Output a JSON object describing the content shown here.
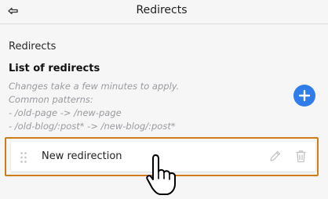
{
  "header": {
    "title": "Redirects",
    "back_icon": "back-arrow-icon"
  },
  "section": {
    "label": "Redirects"
  },
  "list": {
    "title": "List of redirects",
    "help_lines": [
      "Changes take a few minutes to apply.",
      "Common patterns:",
      "- /old-page -> /new-page",
      "- /old-blog/:post* -> /new-blog/:post*"
    ],
    "add_icon": "plus-icon"
  },
  "items": [
    {
      "label": "New redirection",
      "drag_icon": "drag-handle-icon",
      "edit_icon": "pencil-icon",
      "delete_icon": "trash-icon"
    }
  ],
  "colors": {
    "accent": "#2f7dea",
    "highlight": "#d07c19"
  },
  "cursor": "hand-pointer-icon"
}
